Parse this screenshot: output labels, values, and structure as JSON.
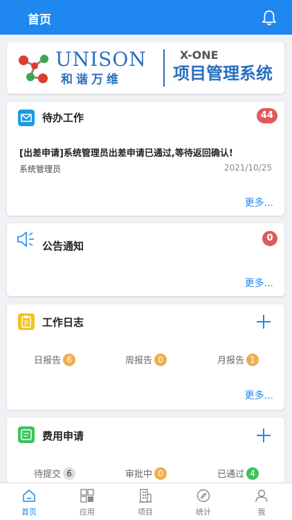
{
  "header": {
    "title": "首页"
  },
  "banner": {
    "logo_word": "UNISON",
    "logo_cn": "和谐万维",
    "product_line": "X-ONE",
    "product_name": "项目管理系统"
  },
  "todo": {
    "title": "待办工作",
    "count": "44",
    "item": {
      "subject": "[出差申请]系统管理员出差申请已通过,等待返回确认!",
      "user": "系统管理员",
      "date": "2021/10/25"
    },
    "more": "更多..."
  },
  "notice": {
    "title": "公告通知",
    "count": "0",
    "more": "更多..."
  },
  "worklog": {
    "title": "工作日志",
    "stats": [
      {
        "label": "日报告",
        "count": "6"
      },
      {
        "label": "周报告",
        "count": "0"
      },
      {
        "label": "月报告",
        "count": "1"
      }
    ],
    "more": "更多..."
  },
  "expense": {
    "title": "费用申请",
    "stats": [
      {
        "label": "待提交",
        "count": "6"
      },
      {
        "label": "审批中",
        "count": "0"
      },
      {
        "label": "已通过",
        "count": "4"
      }
    ]
  },
  "tabbar": {
    "items": [
      {
        "label": "首页",
        "icon": "home-icon"
      },
      {
        "label": "应用",
        "icon": "apps-icon"
      },
      {
        "label": "项目",
        "icon": "building-icon"
      },
      {
        "label": "统计",
        "icon": "compass-icon"
      },
      {
        "label": "我",
        "icon": "user-icon"
      }
    ]
  },
  "colors": {
    "primary": "#1e87f0",
    "badge_red": "#e15a5a",
    "badge_orange": "#f0ad4e",
    "badge_green": "#3cc35c"
  }
}
